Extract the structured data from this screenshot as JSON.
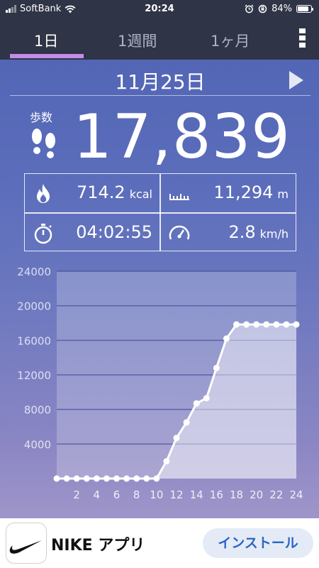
{
  "status_bar": {
    "carrier": "SoftBank",
    "time": "20:24",
    "battery": "84%",
    "battery_level": 0.84
  },
  "tabs": [
    {
      "label": "1日",
      "active": true
    },
    {
      "label": "1週間",
      "active": false
    },
    {
      "label": "1ヶ月",
      "active": false
    }
  ],
  "date": "11月25日",
  "steps": {
    "label": "歩数",
    "value": "17,839"
  },
  "stats": {
    "calories": {
      "value": "714.2",
      "unit": "kcal"
    },
    "distance": {
      "value": "11,294",
      "unit": "m"
    },
    "duration": {
      "value": "04:02:55"
    },
    "speed": {
      "value": "2.8",
      "unit": "km/h"
    }
  },
  "colors": {
    "accent": "#c28de6",
    "header_bg": "#2f3446",
    "install_text": "#2a66c5"
  },
  "chart_data": {
    "type": "area",
    "x": [
      0,
      1,
      2,
      3,
      4,
      5,
      6,
      7,
      8,
      9,
      10,
      11,
      12,
      13,
      14,
      15,
      16,
      17,
      18,
      19,
      20,
      21,
      22,
      23,
      24
    ],
    "values": [
      0,
      0,
      0,
      0,
      0,
      0,
      0,
      0,
      0,
      0,
      0,
      2000,
      4700,
      6500,
      8700,
      9300,
      12800,
      16200,
      17839,
      17839,
      17839,
      17839,
      17839,
      17839,
      17839
    ],
    "x_tick_labels": [
      "2",
      "4",
      "6",
      "8",
      "10",
      "12",
      "14",
      "16",
      "18",
      "20",
      "22",
      "24"
    ],
    "y_tick_labels": [
      "4000",
      "8000",
      "12000",
      "16000",
      "20000",
      "24000"
    ],
    "ylim": [
      0,
      24000
    ],
    "xlim": [
      0,
      24
    ],
    "grid": true
  },
  "ad": {
    "app_name": "NIKE アプリ",
    "install_label": "インストール"
  }
}
